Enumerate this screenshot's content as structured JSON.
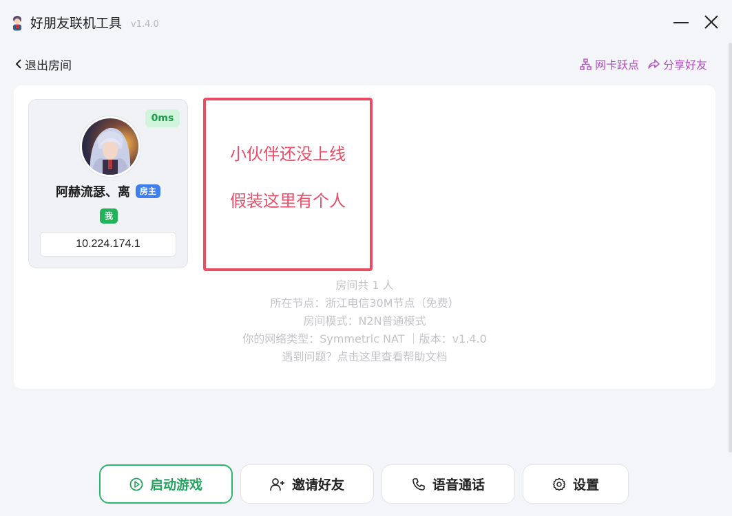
{
  "app": {
    "title": "好朋友联机工具",
    "version": "v1.4.0"
  },
  "header": {
    "back_label": "退出房间",
    "actions": [
      {
        "label": "网卡跃点",
        "icon": "network-icon"
      },
      {
        "label": "分享好友",
        "icon": "share-icon"
      }
    ]
  },
  "member": {
    "ping": "0ms",
    "name": "阿赫流瑟、离",
    "host_badge": "房主",
    "me_badge": "我",
    "ip": "10.224.174.1"
  },
  "placeholder": {
    "line1": "小伙伴还没上线",
    "line2": "假装这里有个人"
  },
  "info": {
    "room_count": "房间共 1 人",
    "node": "所在节点：浙江电信30M节点（免费）",
    "mode": "房间模式：N2N普通模式",
    "network": "你的网络类型：Symmetric NAT ｜版本：v1.4.0",
    "help": "遇到问题？点击这里查看帮助文档"
  },
  "buttons": {
    "start_game": "启动游戏",
    "invite": "邀请好友",
    "voice": "语音通话",
    "settings": "设置"
  },
  "colors": {
    "accent_purple": "#b14fc4",
    "accent_green": "#22a45f",
    "placeholder_red": "#e84f68",
    "host_blue": "#3f7ef0"
  }
}
